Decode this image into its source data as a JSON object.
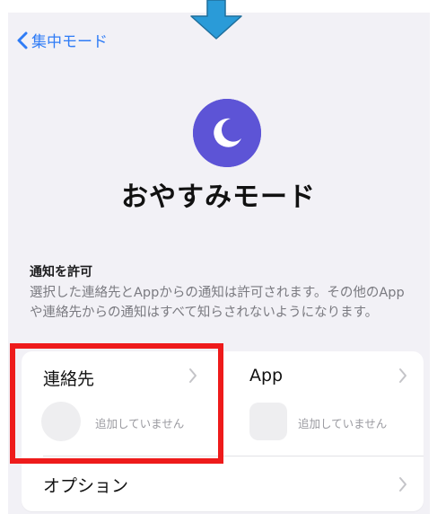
{
  "nav": {
    "back_label": "集中モード"
  },
  "mode": {
    "title": "おやすみモード",
    "accent_color": "#5d54d6",
    "icon": "moon-icon"
  },
  "allow_notifications": {
    "title": "通知を許可",
    "description": "選択した連絡先とAppからの通知は許可されます。その他のAppや連絡先からの通知はすべて知らされないようになります。"
  },
  "contacts": {
    "label": "連絡先",
    "empty_text": "追加していません"
  },
  "apps": {
    "label": "App",
    "empty_text": "追加していません"
  },
  "options": {
    "label": "オプション"
  },
  "annotations": {
    "arrow_color": "#2a9bd8",
    "highlight_color": "#ee1b1b"
  }
}
